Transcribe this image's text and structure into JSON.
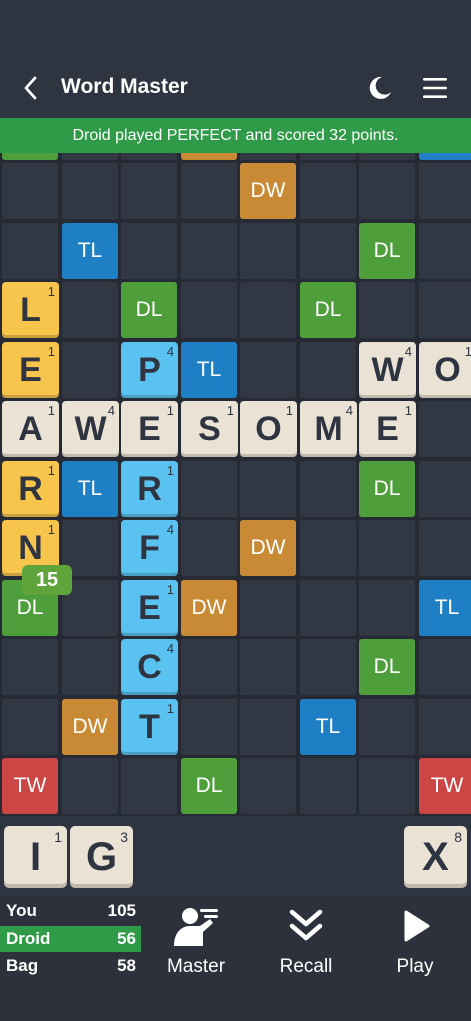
{
  "header": {
    "title": "Word Master",
    "icons": [
      "chevron-left-icon",
      "moon-icon",
      "menu-icon"
    ]
  },
  "banner": {
    "text": "Droid played PERFECT and scored 32 points."
  },
  "board": {
    "bonuses": [
      {
        "label": "DW",
        "type": "dw",
        "c": 4,
        "r": 0
      },
      {
        "label": "TL",
        "type": "tl",
        "c": 1,
        "r": 1
      },
      {
        "label": "DL",
        "type": "dl",
        "c": 6,
        "r": 1
      },
      {
        "label": "DL",
        "type": "dl",
        "c": 2,
        "r": 2
      },
      {
        "label": "DL",
        "type": "dl",
        "c": 5,
        "r": 2
      },
      {
        "label": "TL",
        "type": "tl",
        "c": 3,
        "r": 3
      },
      {
        "label": "TL",
        "type": "tl",
        "c": 1,
        "r": 5
      },
      {
        "label": "DL",
        "type": "dl",
        "c": 6,
        "r": 5
      },
      {
        "label": "DW",
        "type": "dw",
        "c": 4,
        "r": 6
      },
      {
        "label": "DL",
        "type": "dl",
        "c": 0,
        "r": 7
      },
      {
        "label": "DW",
        "type": "dw",
        "c": 3,
        "r": 7
      },
      {
        "label": "TL",
        "type": "tl",
        "c": 7,
        "r": 7
      },
      {
        "label": "DL",
        "type": "dl",
        "c": 6,
        "r": 8
      },
      {
        "label": "DW",
        "type": "dw",
        "c": 1,
        "r": 9
      },
      {
        "label": "TL",
        "type": "tl",
        "c": 5,
        "r": 9
      },
      {
        "label": "TW",
        "type": "tw",
        "c": 0,
        "r": 10
      },
      {
        "label": "DL",
        "type": "dl",
        "c": 3,
        "r": 10
      },
      {
        "label": "TW",
        "type": "tw",
        "c": 7,
        "r": 10
      }
    ],
    "tiles": [
      {
        "letter": "L",
        "points": "1",
        "color": "yellow",
        "c": 0,
        "r": 2
      },
      {
        "letter": "E",
        "points": "1",
        "color": "yellow",
        "c": 0,
        "r": 3
      },
      {
        "letter": "R",
        "points": "1",
        "color": "yellow",
        "c": 0,
        "r": 5
      },
      {
        "letter": "N",
        "points": "1",
        "color": "yellow",
        "c": 0,
        "r": 6
      },
      {
        "letter": "P",
        "points": "4",
        "color": "blue",
        "c": 2,
        "r": 3
      },
      {
        "letter": "R",
        "points": "1",
        "color": "blue",
        "c": 2,
        "r": 5
      },
      {
        "letter": "F",
        "points": "4",
        "color": "blue",
        "c": 2,
        "r": 6
      },
      {
        "letter": "E",
        "points": "1",
        "color": "blue",
        "c": 2,
        "r": 7
      },
      {
        "letter": "C",
        "points": "4",
        "color": "blue",
        "c": 2,
        "r": 8
      },
      {
        "letter": "T",
        "points": "1",
        "color": "blue",
        "c": 2,
        "r": 9
      },
      {
        "letter": "W",
        "points": "4",
        "color": "beige",
        "c": 6,
        "r": 3
      },
      {
        "letter": "O",
        "points": "1",
        "color": "beige",
        "c": 7,
        "r": 3
      },
      {
        "letter": "A",
        "points": "1",
        "color": "beige",
        "c": 0,
        "r": 4
      },
      {
        "letter": "W",
        "points": "4",
        "color": "beige",
        "c": 1,
        "r": 4
      },
      {
        "letter": "E",
        "points": "1",
        "color": "beige",
        "c": 2,
        "r": 4
      },
      {
        "letter": "S",
        "points": "1",
        "color": "beige",
        "c": 3,
        "r": 4
      },
      {
        "letter": "O",
        "points": "1",
        "color": "beige",
        "c": 4,
        "r": 4
      },
      {
        "letter": "M",
        "points": "4",
        "color": "beige",
        "c": 5,
        "r": 4
      },
      {
        "letter": "E",
        "points": "1",
        "color": "beige",
        "c": 6,
        "r": 4
      }
    ],
    "score_badge": "15",
    "colors": {
      "dl": "#4f9e3c",
      "tl": "#1f7fc4",
      "dw": "#c98a36",
      "tw": "#cc4646",
      "tile": "#e9e2d5",
      "new_tile": "#5ac2f0",
      "my_tile": "#f7c54c"
    }
  },
  "rack": [
    {
      "letter": "I",
      "points": "1"
    },
    {
      "letter": "G",
      "points": "3"
    },
    {
      "letter": "X",
      "points": "8"
    }
  ],
  "scores": [
    {
      "name": "You",
      "score": "105"
    },
    {
      "name": "Droid",
      "score": "56"
    },
    {
      "name": "Bag",
      "score": "58"
    }
  ],
  "actions": [
    {
      "label": "Master",
      "icon": "master-icon"
    },
    {
      "label": "Recall",
      "icon": "recall-icon"
    },
    {
      "label": "Play",
      "icon": "play-icon"
    }
  ]
}
